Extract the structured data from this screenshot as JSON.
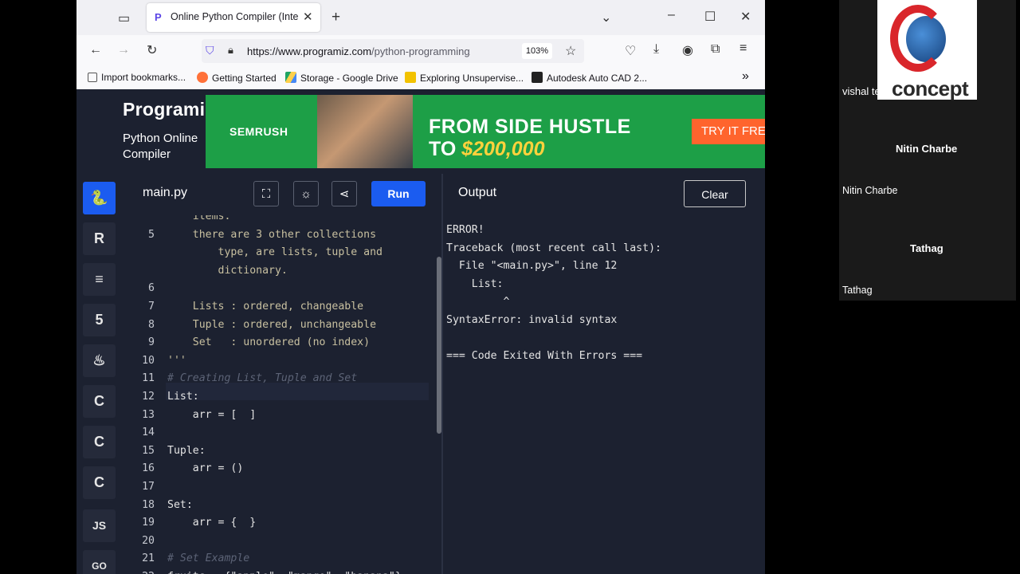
{
  "browser": {
    "tab_title": "Online Python Compiler (Interp",
    "tab_favicon": "P",
    "url_domain": "https://www.programiz.com",
    "url_path": "/python-programming/online-compiler/",
    "zoom": "103%",
    "bookmarks": [
      {
        "label": "Import bookmarks...",
        "icon": "import-icon",
        "color": "#555555"
      },
      {
        "label": "Getting Started",
        "icon": "firefox-icon",
        "color": "#ff7139"
      },
      {
        "label": "Storage - Google Drive",
        "icon": "google-drive-icon",
        "color": "#1fa463"
      },
      {
        "label": "Exploring Unsupervise...",
        "icon": "k-icon",
        "color": "#f2c200"
      },
      {
        "label": "Autodesk Auto CAD 2...",
        "icon": "autodesk-icon",
        "color": "#222222"
      }
    ]
  },
  "header": {
    "logo": "Programiz",
    "subtitle": "Python Online Compiler"
  },
  "ad": {
    "brand": "SEMRUSH",
    "headline_1": "FROM SIDE HUSTLE",
    "headline_2_prefix": "TO ",
    "headline_2_amount": "$200,000",
    "cta": "TRY IT FREE"
  },
  "sidebar": {
    "languages": [
      {
        "name": "python",
        "glyph": "🐍",
        "active": true
      },
      {
        "name": "r",
        "glyph": "R"
      },
      {
        "name": "sql",
        "glyph": "≡"
      },
      {
        "name": "html",
        "glyph": "5"
      },
      {
        "name": "java",
        "glyph": "♨"
      },
      {
        "name": "c",
        "glyph": "C"
      },
      {
        "name": "cpp",
        "glyph": "C"
      },
      {
        "name": "csharp",
        "glyph": "C"
      },
      {
        "name": "javascript",
        "glyph": "JS"
      },
      {
        "name": "go",
        "glyph": "GO"
      }
    ]
  },
  "editor": {
    "file_name": "main.py",
    "run_label": "Run",
    "lines": [
      {
        "num": "",
        "text": "    items:",
        "kind": "str"
      },
      {
        "num": "5",
        "text": "    there are 3 other collections",
        "kind": "str"
      },
      {
        "num": "",
        "text": "        type, are lists, tuple and",
        "kind": "str"
      },
      {
        "num": "",
        "text": "        dictionary.",
        "kind": "str"
      },
      {
        "num": "6",
        "text": "",
        "kind": "str"
      },
      {
        "num": "7",
        "text": "    Lists : ordered, changeable",
        "kind": "str"
      },
      {
        "num": "8",
        "text": "    Tuple : ordered, unchangeable",
        "kind": "str"
      },
      {
        "num": "9",
        "text": "    Set   : unordered (no index)",
        "kind": "str"
      },
      {
        "num": "10",
        "text": "'''",
        "kind": "str"
      },
      {
        "num": "11",
        "text": "# Creating List, Tuple and Set",
        "kind": "cmt"
      },
      {
        "num": "12",
        "text": "List:",
        "kind": "code"
      },
      {
        "num": "13",
        "text": "    arr = [  ]",
        "kind": "code"
      },
      {
        "num": "14",
        "text": "",
        "kind": "code"
      },
      {
        "num": "15",
        "text": "Tuple:",
        "kind": "code"
      },
      {
        "num": "16",
        "text": "    arr = ()",
        "kind": "code"
      },
      {
        "num": "17",
        "text": "",
        "kind": "code"
      },
      {
        "num": "18",
        "text": "Set:",
        "kind": "code"
      },
      {
        "num": "19",
        "text": "    arr = {  }",
        "kind": "code"
      },
      {
        "num": "20",
        "text": "",
        "kind": "code"
      },
      {
        "num": "21",
        "text": "# Set Example",
        "kind": "cmt"
      },
      {
        "num": "22",
        "text": "fruits = {\"apple\", \"mango\", \"banana\"}",
        "kind": "code"
      }
    ]
  },
  "output": {
    "title": "Output",
    "clear_label": "Clear",
    "lines": [
      "ERROR!",
      "Traceback (most recent call last):",
      "  File \"<main.py>\", line 12",
      "    List:",
      "         ^",
      "SyntaxError: invalid syntax",
      "",
      "=== Code Exited With Errors ==="
    ]
  },
  "meeting": {
    "participants": [
      {
        "name": "vishal teli",
        "bold": false
      },
      {
        "name": "Nitin Charbe",
        "bold": true
      },
      {
        "name": "Nitin Charbe",
        "bold": false
      },
      {
        "name": "Tathag",
        "bold": true
      },
      {
        "name": "Tathag",
        "bold": false
      }
    ],
    "logo_text": "concept"
  }
}
